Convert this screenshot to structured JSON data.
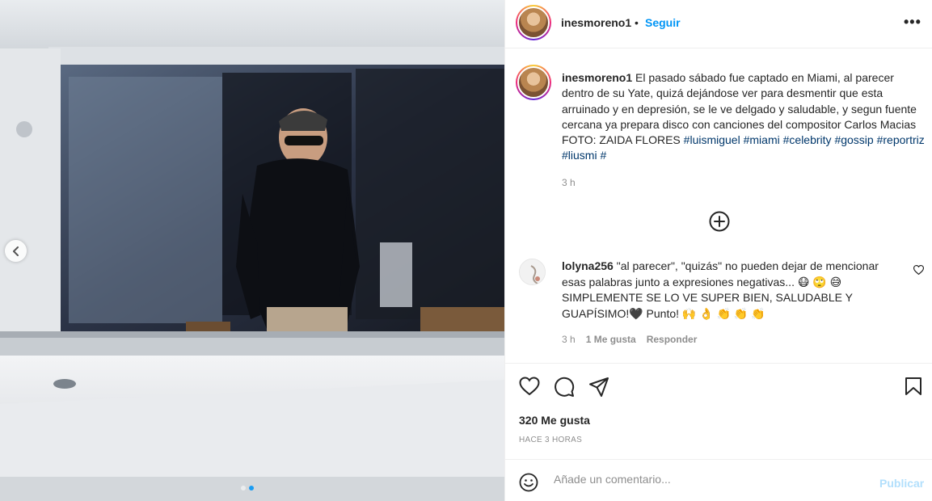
{
  "post": {
    "username": "inesmoreno1",
    "separator": "•",
    "follow_label": "Seguir",
    "more_label": "•••",
    "caption_text": "El pasado sábado fue captado en Miami, al parecer dentro de su Yate, quizá dejándose ver para desmentir que esta arruinado y en depresión, se le ve delgado y saludable, y segun fuente cercana ya prepara disco con canciones del compositor Carlos Macias FOTO: ZAIDA FLORES",
    "hashtags": [
      "#luismiguel",
      "#miami",
      "#celebrity",
      "#gossip",
      "#reportriz",
      "#liusmi",
      "#"
    ],
    "caption_time": "3 h",
    "likes": "320 Me gusta",
    "posted_ago": "HACE 3 HORAS",
    "carousel": {
      "slides": 2,
      "active": 2
    }
  },
  "comment": {
    "username": "lolyna256",
    "text_line1": "\"al parecer\", \"quizás\" no pueden dejar de mencionar esas palabras junto a expresiones negativas...",
    "emojis_1": "😷 🙄 😅",
    "text_line2": "SIMPLEMENTE SE LO VE SUPER BIEN, SALUDABLE Y GUAPÍSIMO!🖤 Punto!",
    "emojis_2": "🙌 👌 👏 👏 👏",
    "time": "3 h",
    "likes": "1 Me gusta",
    "reply_label": "Responder"
  },
  "composer": {
    "placeholder": "Añade un comentario...",
    "post_label": "Publicar"
  },
  "icons": {
    "carousel_prev": "chevron-left-icon",
    "load_more": "plus-circle-icon",
    "like": "heart-icon",
    "comment": "comment-icon",
    "share": "paper-plane-icon",
    "save": "bookmark-icon",
    "emoji": "smiley-icon"
  },
  "colors": {
    "link_blue": "#0095f6",
    "hashtag": "#00376b",
    "muted": "#8e8e8e",
    "disabled_blue": "#b2dffc"
  }
}
